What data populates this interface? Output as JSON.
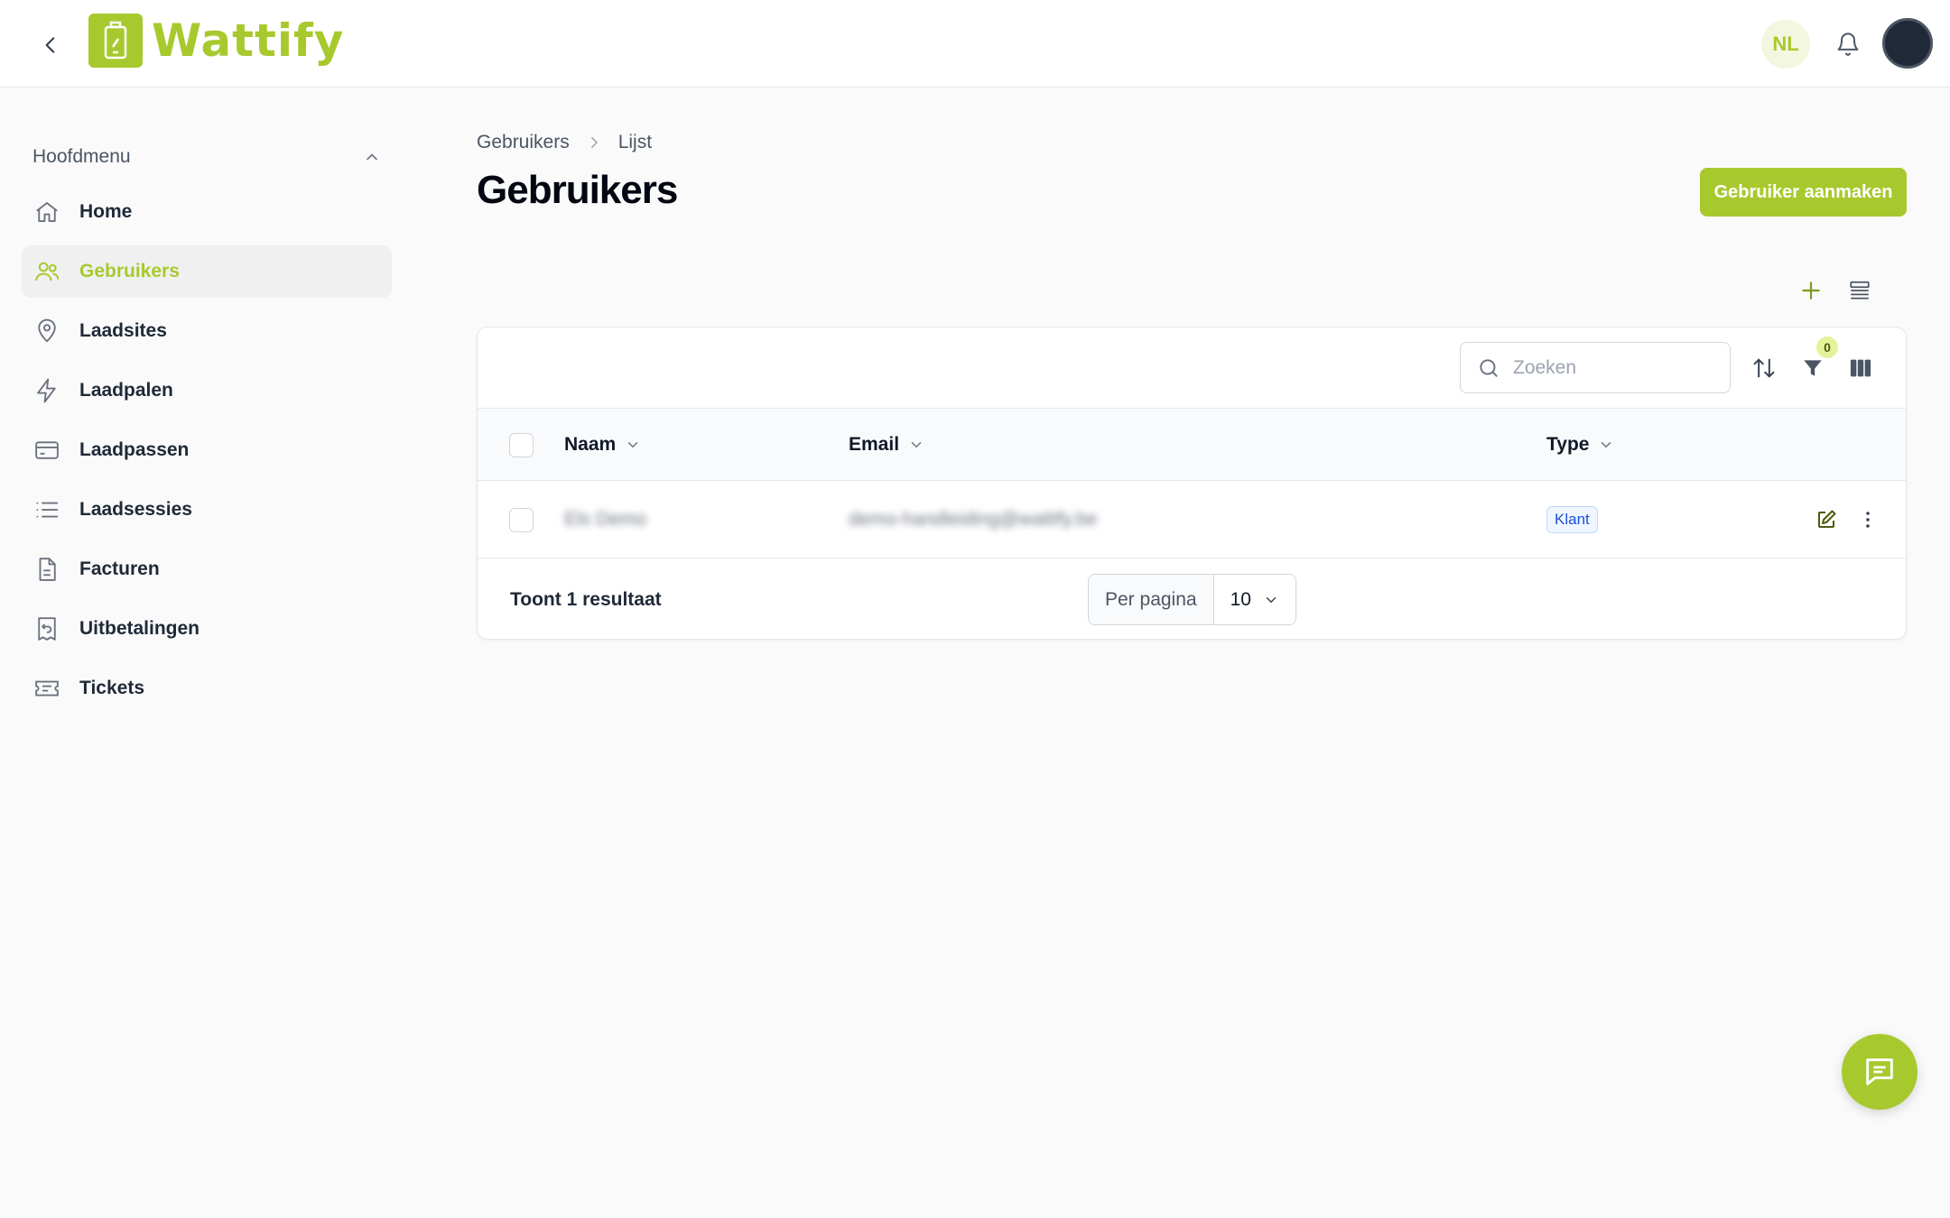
{
  "brand": {
    "name": "Wattify",
    "accent": "#a8c92e"
  },
  "header": {
    "language": "NL"
  },
  "sidebar": {
    "title": "Hoofdmenu",
    "items": [
      {
        "label": "Home",
        "icon": "home-icon"
      },
      {
        "label": "Gebruikers",
        "icon": "users-icon",
        "active": true
      },
      {
        "label": "Laadsites",
        "icon": "map-pin-icon"
      },
      {
        "label": "Laadpalen",
        "icon": "bolt-icon"
      },
      {
        "label": "Laadpassen",
        "icon": "credit-card-icon"
      },
      {
        "label": "Laadsessies",
        "icon": "list-icon"
      },
      {
        "label": "Facturen",
        "icon": "document-icon"
      },
      {
        "label": "Uitbetalingen",
        "icon": "receipt-refund-icon"
      },
      {
        "label": "Tickets",
        "icon": "ticket-icon"
      }
    ]
  },
  "breadcrumb": {
    "parent": "Gebruikers",
    "current": "Lijst"
  },
  "page": {
    "title": "Gebruikers",
    "create_button": "Gebruiker aanmaken"
  },
  "table": {
    "search_placeholder": "Zoeken",
    "filter_count": "0",
    "columns": {
      "name": "Naam",
      "email": "Email",
      "type": "Type"
    },
    "rows": [
      {
        "name": "Els Demo",
        "email": "demo-handleiding@wattify.be",
        "type": "Klant"
      }
    ],
    "result_text": "Toont 1 resultaat",
    "per_page_label": "Per pagina",
    "per_page_value": "10"
  }
}
